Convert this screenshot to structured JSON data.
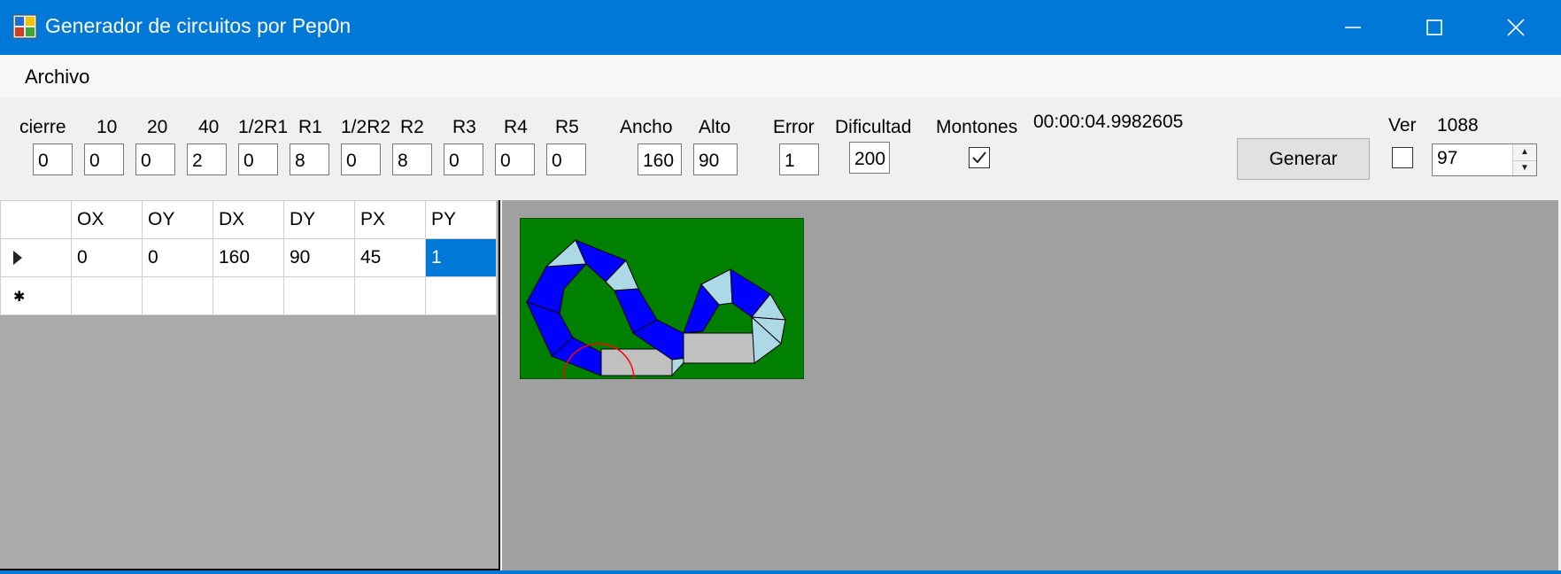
{
  "window": {
    "title": "Generador de circuitos por Pep0n"
  },
  "menu": {
    "items": [
      "Archivo"
    ]
  },
  "params": {
    "cierre": {
      "label": "cierre",
      "value": "0"
    },
    "p10": {
      "label": "10",
      "value": "0"
    },
    "p20": {
      "label": "20",
      "value": "0"
    },
    "p40": {
      "label": "40",
      "value": "2"
    },
    "half_r1": {
      "label": "1/2R1",
      "value": "0"
    },
    "r1": {
      "label": "R1",
      "value": "8"
    },
    "half_r2": {
      "label": "1/2R2",
      "value": "0"
    },
    "r2": {
      "label": "R2",
      "value": "8"
    },
    "r3": {
      "label": "R3",
      "value": "0"
    },
    "r4": {
      "label": "R4",
      "value": "0"
    },
    "r5": {
      "label": "R5",
      "value": "0"
    },
    "ancho": {
      "label": "Ancho",
      "value": "160"
    },
    "alto": {
      "label": "Alto",
      "value": "90"
    },
    "error": {
      "label": "Error",
      "value": "1"
    },
    "dificultad": {
      "label": "Dificultad",
      "value": "200"
    },
    "montones": {
      "label": "Montones",
      "checked": true
    }
  },
  "timer": "00:00:04.9982605",
  "generate_label": "Generar",
  "ver": {
    "label": "Ver",
    "checked": false,
    "count": "1088",
    "spinner_value": "97"
  },
  "grid": {
    "columns": [
      "OX",
      "OY",
      "DX",
      "DY",
      "PX",
      "PY"
    ],
    "rows": [
      [
        "0",
        "0",
        "160",
        "90",
        "45",
        "1"
      ]
    ],
    "selected_cell": {
      "row": 0,
      "col": 5
    }
  },
  "colors": {
    "titlebar": "#0078d7",
    "canvas_bg": "#008000",
    "track_blue": "#0000ff",
    "track_light": "#add8e6",
    "track_gray": "#c0c0c0",
    "marker": "#ff0000"
  }
}
